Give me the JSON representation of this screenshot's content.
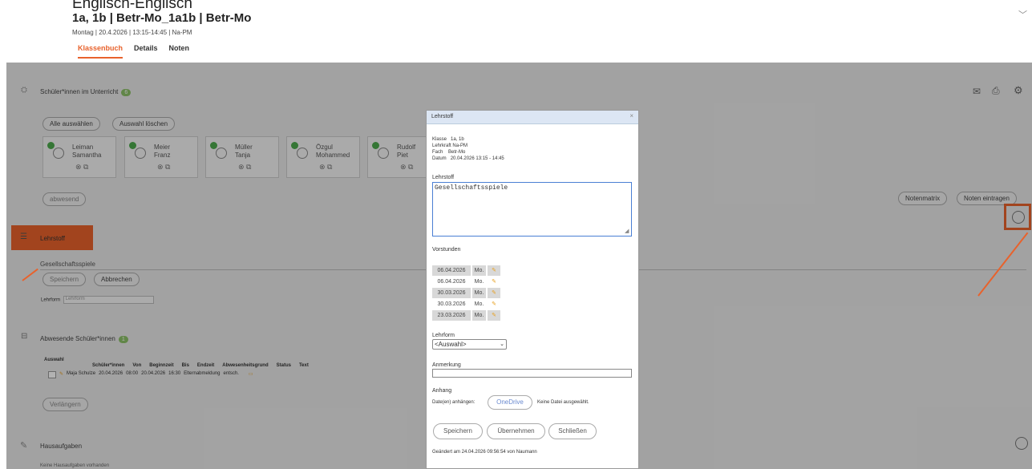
{
  "header": {
    "top_partial": "Englisch-Englisch",
    "title": "1a, 1b | Betr-Mo_1a1b | Betr-Mo",
    "meta": "Montag | 20.4.2026 | 13:15-14:45 | Na-PM",
    "tabs": [
      "Klassenbuch",
      "Details",
      "Noten"
    ]
  },
  "students_section": {
    "title": "Schüler*innen im Unterricht",
    "count": "6",
    "select_all": "Alle auswählen",
    "clear_selection": "Auswahl löschen",
    "absent_btn": "abwesend",
    "grade_matrix": "Notenmatrix",
    "enter_grades": "Noten eintragen",
    "students": [
      {
        "first": "Leiman",
        "second": "Samantha"
      },
      {
        "first": "Meier",
        "second": "Franz"
      },
      {
        "first": "Müller",
        "second": "Tanja"
      },
      {
        "first": "Özgul",
        "second": "Mohammed"
      },
      {
        "first": "Rudolf",
        "second": "Piet"
      }
    ]
  },
  "lehrstoff_section": {
    "title": "Lehrstoff",
    "value": "Gesellschaftsspiele",
    "save": "Speichern",
    "cancel": "Abbrechen",
    "form_label": "Lehrform",
    "form_placeholder": "Lehrform"
  },
  "absent_section": {
    "title": "Abwesende Schüler*innen",
    "count": "1",
    "select_label": "Auswahl",
    "columns": [
      "Schüler*innen",
      "Von",
      "Beginnzeit",
      "Bis",
      "Endzeit",
      "Abwesenheitsgrund",
      "Status",
      "Text"
    ],
    "row": {
      "name": "Maja Schulze",
      "from": "20.04.2026",
      "start": "08:00",
      "to": "20.04.2026",
      "end": "16:30",
      "reason": "Elternabmeldung",
      "status": "entsch."
    },
    "extend": "Verlängern"
  },
  "homework_section": {
    "title": "Hausaufgaben",
    "empty": "Keine Hausaufgaben vorhanden"
  },
  "modal": {
    "title": "Lehrstoff",
    "close": "×",
    "info": [
      [
        "Klasse",
        "1a, 1b"
      ],
      [
        "Lehrkraft",
        "Na-PM"
      ],
      [
        "Fach",
        "Betr-Mo"
      ],
      [
        "Datum",
        "20.04.2026 13:15 - 14:45"
      ]
    ],
    "lehrstoff_label": "Lehrstoff",
    "lehrstoff_value": "Gesellschaftsspiele",
    "prev_label": "Vorstunden",
    "prev": [
      {
        "date": "06.04.2026",
        "day": "Mo."
      },
      {
        "date": "06.04.2026",
        "day": "Mo."
      },
      {
        "date": "30.03.2026",
        "day": "Mo."
      },
      {
        "date": "30.03.2026",
        "day": "Mo."
      },
      {
        "date": "23.03.2026",
        "day": "Mo."
      }
    ],
    "lehrform_label": "Lehrform",
    "lehrform_value": "<Auswahl>",
    "note_label": "Anmerkung",
    "attach_label": "Anhang",
    "attach_prefix": "Date(en) anhängen:",
    "onedrive": "OneDrive",
    "no_file": "Keine Datei ausgewählt.",
    "save": "Speichern",
    "apply": "Übernehmen",
    "close_btn": "Schließen",
    "changed": "Geändert am 24.04.2026 09:56:54 von Naumann"
  },
  "colors": {
    "accent": "#e8622c",
    "badge": "#8cc068",
    "dialog_border": "#4a7fd4"
  }
}
